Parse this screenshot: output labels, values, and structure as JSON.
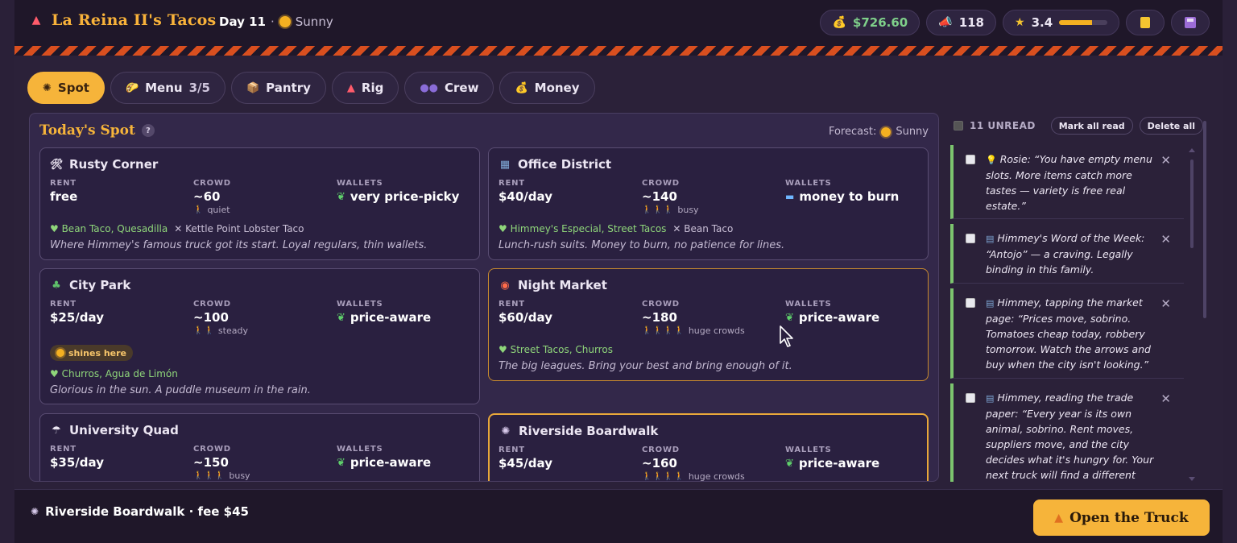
{
  "header": {
    "title": "La Reina II's Tacos",
    "day": "Day 11",
    "weather": "Sunny",
    "money": "$726.60",
    "fans": "118",
    "rating": "3.4",
    "rating_fraction": 0.68
  },
  "tabs": [
    {
      "label": "Spot",
      "count": "",
      "active": true
    },
    {
      "label": "Menu",
      "count": "3/5",
      "active": false
    },
    {
      "label": "Pantry",
      "count": "",
      "active": false
    },
    {
      "label": "Rig",
      "count": "",
      "active": false
    },
    {
      "label": "Crew",
      "count": "",
      "active": false
    },
    {
      "label": "Money",
      "count": "",
      "active": false
    }
  ],
  "spot": {
    "title": "Today's Spot",
    "help": "?",
    "forecast_label": "Forecast:",
    "forecast": "Sunny",
    "labels": {
      "rent": "RENT",
      "crowd": "CROWD",
      "wallets": "WALLETS"
    },
    "cards": [
      {
        "name": "Rusty Corner",
        "rent": "free",
        "crowd": "~60",
        "crowd_note": "quiet",
        "crowd_figs": "🚶",
        "wallets": "very price-picky",
        "likes": "Bean Taco, Quesadilla",
        "dislikes": "Kettle Point Lobster Taco",
        "desc": "Where Himmey's famous truck got its start. Loyal regulars, thin wallets.",
        "shines": ""
      },
      {
        "name": "Office District",
        "rent": "$40/day",
        "crowd": "~140",
        "crowd_note": "busy",
        "crowd_figs": "🚶🚶🚶",
        "wallets": "money to burn",
        "likes": "Himmey's Especial, Street Tacos",
        "dislikes": "Bean Taco",
        "desc": "Lunch-rush suits. Money to burn, no patience for lines.",
        "shines": ""
      },
      {
        "name": "City Park",
        "rent": "$25/day",
        "crowd": "~100",
        "crowd_note": "steady",
        "crowd_figs": "🚶🚶",
        "wallets": "price-aware",
        "likes": "Churros, Agua de Limón",
        "dislikes": "",
        "desc": "Glorious in the sun. A puddle museum in the rain.",
        "shines": "shines here"
      },
      {
        "name": "Night Market",
        "rent": "$60/day",
        "crowd": "~180",
        "crowd_note": "huge crowds",
        "crowd_figs": "🚶🚶🚶🚶",
        "wallets": "price-aware",
        "likes": "Street Tacos, Churros",
        "dislikes": "",
        "desc": "The big leagues. Bring your best and bring enough of it.",
        "shines": ""
      },
      {
        "name": "University Quad",
        "rent": "$35/day",
        "crowd": "~150",
        "crowd_note": "busy",
        "crowd_figs": "🚶🚶🚶",
        "wallets": "price-aware",
        "likes": "",
        "dislikes": "",
        "desc": "",
        "shines": ""
      },
      {
        "name": "Riverside Boardwalk",
        "rent": "$45/day",
        "crowd": "~160",
        "crowd_note": "huge crowds",
        "crowd_figs": "🚶🚶🚶🚶",
        "wallets": "price-aware",
        "likes": "",
        "dislikes": "",
        "desc": "",
        "shines": ""
      }
    ]
  },
  "inbox": {
    "unread": "11 UNREAD",
    "mark_all": "Mark all read",
    "delete_all": "Delete all",
    "messages": [
      "Rosie: “You have empty menu slots. More items catch more tastes — variety is free real estate.”",
      "Himmey's Word of the Week: “Antojo” — a craving. Legally binding in this family.",
      "Himmey, tapping the market page: “Prices move, sobrino. Tomatoes cheap today, robbery tomorrow. Watch the arrows and buy when the city isn't looking.”",
      "Himmey, reading the trade paper: “Every year is its own animal, sobrino. Rent moves, suppliers move, and the city decides what it's hungry for. Your next truck will find a different"
    ]
  },
  "footer": {
    "selected": "Riverside Boardwalk · fee $45",
    "open_label": "Open the Truck"
  }
}
